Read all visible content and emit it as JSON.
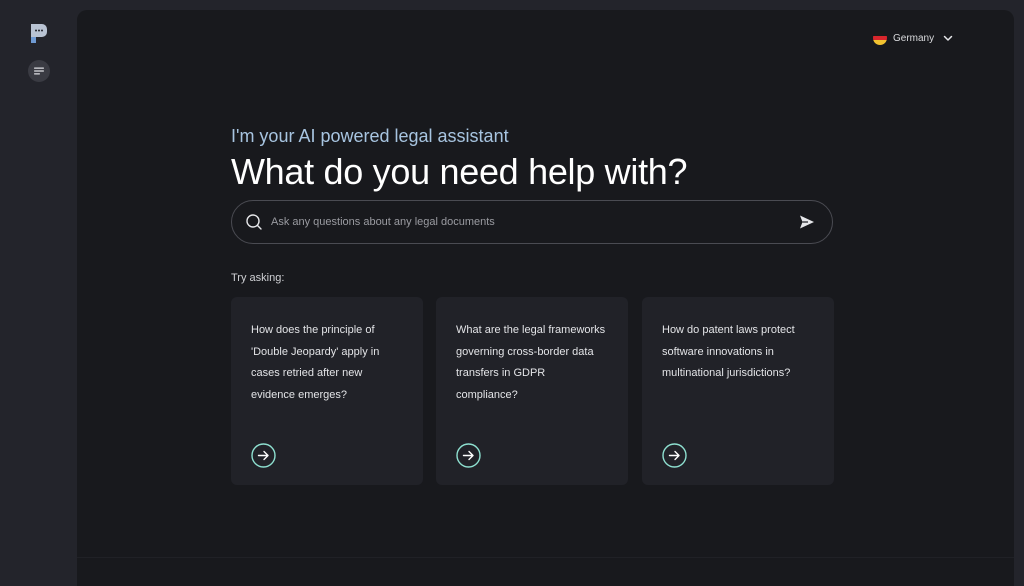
{
  "app": {
    "logo_icon": "chat-bubble-logo-icon",
    "menu_icon": "menu-lines-icon"
  },
  "header": {
    "country": "Germany",
    "country_flag_icon": "germany-flag-icon",
    "dropdown_icon": "chevron-down-icon"
  },
  "hero": {
    "subtitle": "I'm your AI powered legal assistant",
    "title": "What do you need help with?"
  },
  "search": {
    "placeholder": "Ask any questions about any legal documents",
    "value": "",
    "search_icon": "search-icon",
    "send_icon": "send-icon"
  },
  "suggestions": {
    "label": "Try asking:",
    "items": [
      {
        "text": "How does the principle of 'Double Jeopardy' apply in cases retried after new evidence emerges?",
        "icon": "arrow-right-circle-icon"
      },
      {
        "text": "What are the legal frameworks governing cross-border data transfers in GDPR compliance?",
        "icon": "arrow-right-circle-icon"
      },
      {
        "text": "How do patent laws protect software innovations in multinational jurisdictions?",
        "icon": "arrow-right-circle-icon"
      }
    ]
  },
  "colors": {
    "background": "#18191d",
    "sidebar": "#23242b",
    "card": "#212228",
    "accent_subtitle": "#a7c4e0",
    "accent_arrow": "#8ee0d0"
  }
}
